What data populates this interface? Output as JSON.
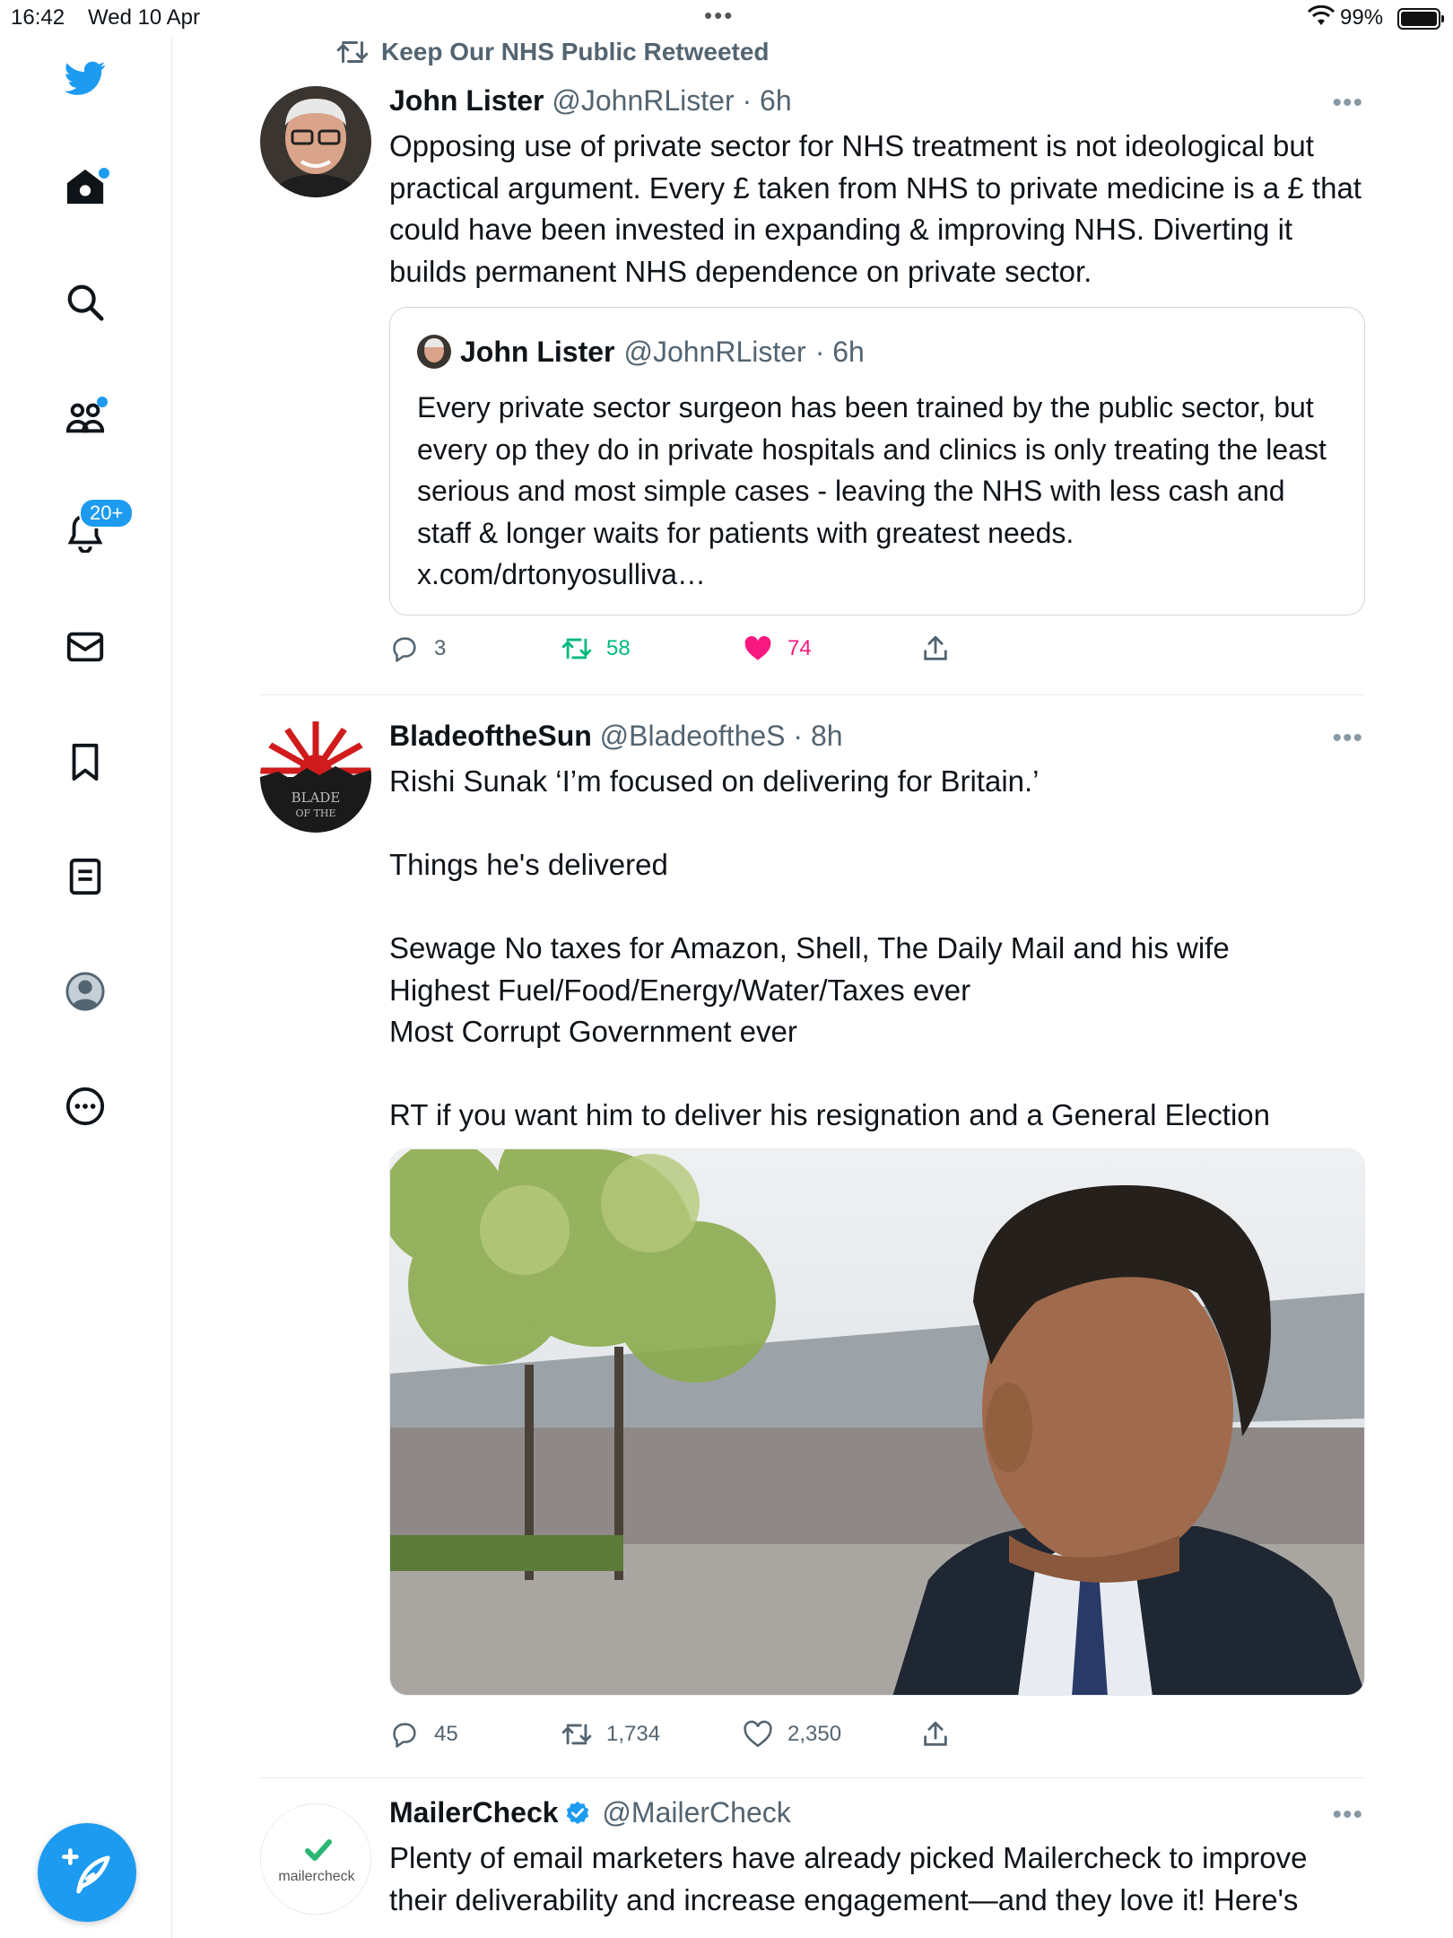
{
  "status_bar": {
    "time": "16:42",
    "date": "Wed 10 Apr",
    "battery": "99%",
    "dots": "•••"
  },
  "sidebar": {
    "notifications_badge": "20+",
    "items": [
      "twitter-logo",
      "home-icon",
      "search-icon",
      "communities-icon",
      "notifications-icon",
      "messages-icon",
      "bookmarks-icon",
      "lists-icon",
      "profile-icon",
      "more-icon"
    ]
  },
  "colors": {
    "accent": "#1d9bf0",
    "retweet_green": "#00ba7c",
    "like_pink": "#f91880",
    "muted": "#536471"
  },
  "feed": {
    "tweet1": {
      "social_context": "Keep Our NHS Public Retweeted",
      "name": "John Lister",
      "handle": "@JohnRLister",
      "time": "· 6h",
      "text": "Opposing use of private sector for NHS treatment is not ideological but practical argument. Every £ taken from NHS to private medicine is a £ that could have been invested in expanding & improving NHS. Diverting it builds permanent NHS dependence on private sector.",
      "quote": {
        "name": "John Lister",
        "handle": "@JohnRLister",
        "time": "· 6h",
        "text": "Every private sector surgeon  has been trained by the public sector, but every op they do in private hospitals and clinics is only treating the least serious and most simple cases - leaving the NHS with less cash and staff & longer waits for patients with greatest needs. x.com/drtonyosulliva…"
      },
      "replies": "3",
      "retweets": "58",
      "likes": "74"
    },
    "tweet2": {
      "name": "BladeoftheSun",
      "handle": "@BladeoftheS",
      "time": "· 8h",
      "avatar_text": "BLADE OF THE",
      "text": "Rishi Sunak ‘I’m focused on delivering for Britain.’\n\nThings he's delivered\n\nSewage No taxes for Amazon, Shell, The Daily Mail and his wife\nHighest Fuel/Food/Energy/Water/Taxes ever\nMost Corrupt Government ever\n\nRT if you want him to deliver his resignation and a General Election",
      "replies": "45",
      "retweets": "1,734",
      "likes": "2,350"
    },
    "tweet3": {
      "name": "MailerCheck",
      "handle": "@MailerCheck",
      "avatar_text": "mailercheck",
      "text": "Plenty of email marketers have already picked Mailercheck to improve their deliverability and increase engagement—and they love it! Here's"
    }
  }
}
